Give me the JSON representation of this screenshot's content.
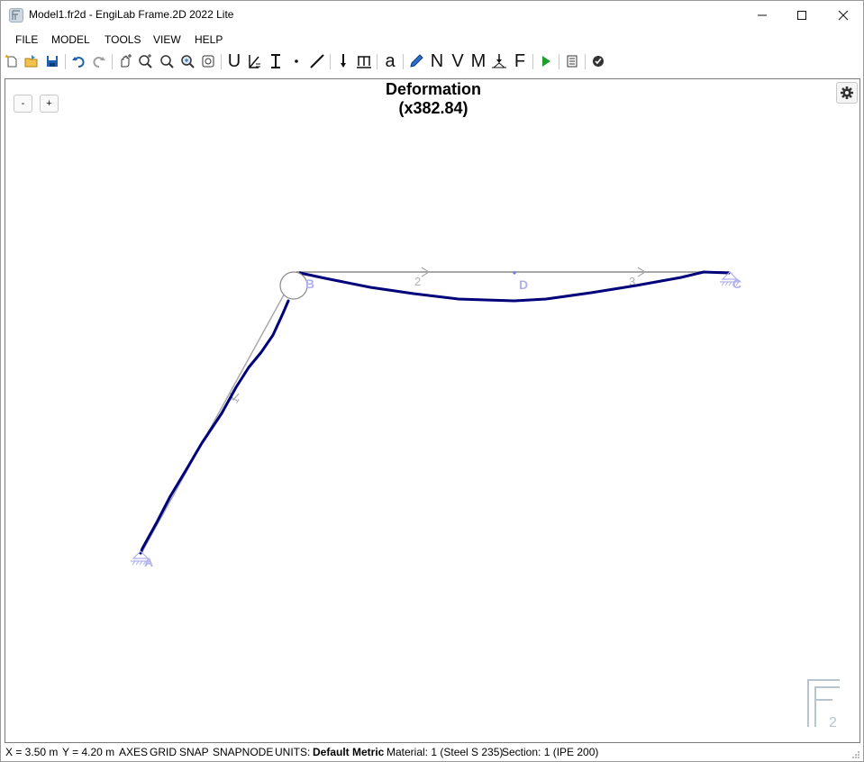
{
  "window": {
    "title": "Model1.fr2d - EngiLab Frame.2D 2022 Lite"
  },
  "menu": {
    "file": "FILE",
    "model": "MODEL",
    "tools": "TOOLS",
    "view": "VIEW",
    "help": "HELP"
  },
  "toolbar": {
    "letters": {
      "u": "U",
      "a": "a",
      "n": "N",
      "v": "V",
      "m": "M",
      "f": "F"
    },
    "icons": [
      "new-icon",
      "open-icon",
      "save-icon",
      "undo-icon",
      "redo-icon",
      "pan-icon",
      "zoom-in-icon",
      "zoom-window-icon",
      "zoom-extents-icon",
      "zoom-previous-icon",
      "supports-icon",
      "releases-icon",
      "sections-icon",
      "node-icon",
      "member-icon",
      "point-load-icon",
      "distributed-load-icon",
      "annotation-icon",
      "edit-icon",
      "axial-force-icon",
      "shear-force-icon",
      "bending-moment-icon",
      "reactions-icon",
      "forces-icon",
      "run-icon",
      "report-icon",
      "check-icon"
    ]
  },
  "canvas": {
    "zoom_out": "-",
    "zoom_in": "+",
    "title_line1": "Deformation",
    "title_line2": "(x382.84)",
    "nodes": {
      "a": "A",
      "b": "B",
      "c": "C",
      "d": "D"
    },
    "members": {
      "m1": "1",
      "m2": "2",
      "m3": "3"
    },
    "watermark_sub": "2"
  },
  "status": {
    "x": "X = 3.50 m",
    "y": "Y = 4.20 m",
    "axes": "AXES",
    "grid": "GRID",
    "snap": "SNAP",
    "snapnode": "SNAPNODE",
    "units_label": "UNITS:",
    "units_value": "Default Metric",
    "material": "Material: 1 (Steel S 235)",
    "section": "Section: 1 (IPE 200)"
  },
  "colors": {
    "deformed": "#00007a",
    "undeformed": "#a8a8a8",
    "node_label": "#b0b0ee",
    "run_green": "#1e9e2e"
  }
}
